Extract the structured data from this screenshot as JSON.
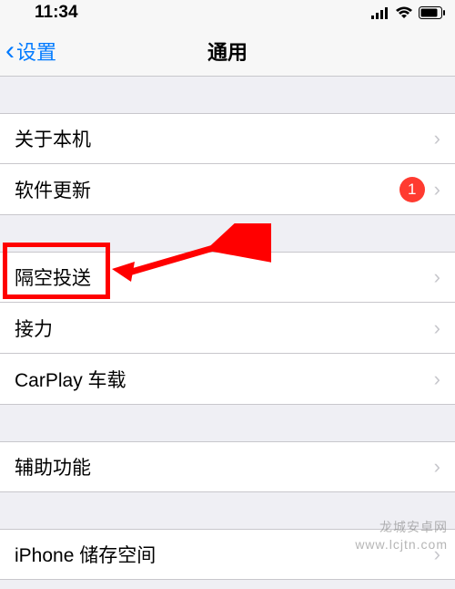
{
  "statusBar": {
    "time": "11:34"
  },
  "nav": {
    "backLabel": "设置",
    "title": "通用"
  },
  "sections": [
    {
      "items": [
        {
          "label": "关于本机",
          "badge": null
        },
        {
          "label": "软件更新",
          "badge": "1"
        }
      ]
    },
    {
      "items": [
        {
          "label": "隔空投送",
          "badge": null,
          "highlighted": true
        },
        {
          "label": "接力",
          "badge": null
        },
        {
          "label": "CarPlay 车载",
          "badge": null
        }
      ]
    },
    {
      "items": [
        {
          "label": "辅助功能",
          "badge": null
        }
      ]
    },
    {
      "items": [
        {
          "label": "iPhone 储存空间",
          "badge": null
        }
      ]
    }
  ],
  "watermark": {
    "line1": "龙城安卓网",
    "line2": "www.lcjtn.com"
  }
}
